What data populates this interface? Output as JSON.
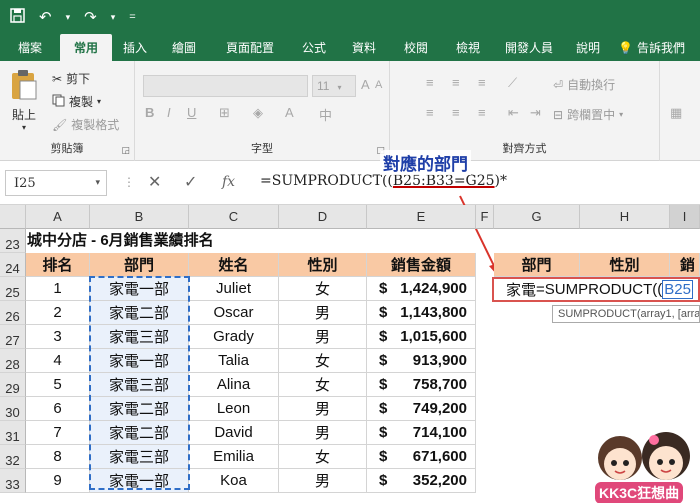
{
  "quick_access": {
    "save_icon": "save-icon",
    "undo_icon": "undo-icon",
    "redo_icon": "redo-icon",
    "customize_icon": "customize-icon"
  },
  "ribbon_tabs": [
    "檔案",
    "常用",
    "插入",
    "繪圖",
    "頁面配置",
    "公式",
    "資料",
    "校閱",
    "檢視",
    "開發人員",
    "說明",
    "告訴我們"
  ],
  "active_tab": "常用",
  "clipboard": {
    "paste": "貼上",
    "cut": "剪下",
    "copy": "複製",
    "format_painter": "複製格式",
    "group_label": "剪貼簿"
  },
  "font_group": {
    "size": "11",
    "group_label": "字型"
  },
  "alignment": {
    "wrap_text": "自動換行",
    "merge_center": "跨欄置中",
    "group_label": "對齊方式"
  },
  "formula_bar": {
    "name_box": "I25",
    "fx": "fx",
    "formula_prefix": "=SUMPRODUCT((",
    "formula_highlight": "B25:B33=G25",
    "formula_suffix": ")*"
  },
  "annotation": "對應的部門",
  "columns": [
    "A",
    "B",
    "C",
    "D",
    "E",
    "F",
    "G",
    "H",
    "I"
  ],
  "sheet_title": "城中分店 - 6月銷售業績排名",
  "table_headers": [
    "排名",
    "部門",
    "姓名",
    "性別",
    "銷售金額"
  ],
  "rows": [
    {
      "row": "25",
      "rank": "1",
      "dept": "家電一部",
      "name": "Juliet",
      "gender": "女",
      "currency": "$",
      "amount": "1,424,900"
    },
    {
      "row": "26",
      "rank": "2",
      "dept": "家電二部",
      "name": "Oscar",
      "gender": "男",
      "currency": "$",
      "amount": "1,143,800"
    },
    {
      "row": "27",
      "rank": "3",
      "dept": "家電三部",
      "name": "Grady",
      "gender": "男",
      "currency": "$",
      "amount": "1,015,600"
    },
    {
      "row": "28",
      "rank": "4",
      "dept": "家電一部",
      "name": "Talia",
      "gender": "女",
      "currency": "$",
      "amount": "913,900"
    },
    {
      "row": "29",
      "rank": "5",
      "dept": "家電三部",
      "name": "Alina",
      "gender": "女",
      "currency": "$",
      "amount": "758,700"
    },
    {
      "row": "30",
      "rank": "6",
      "dept": "家電二部",
      "name": "Leon",
      "gender": "男",
      "currency": "$",
      "amount": "749,200"
    },
    {
      "row": "31",
      "rank": "7",
      "dept": "家電二部",
      "name": "David",
      "gender": "男",
      "currency": "$",
      "amount": "714,100"
    },
    {
      "row": "32",
      "rank": "8",
      "dept": "家電三部",
      "name": "Emilia",
      "gender": "女",
      "currency": "$",
      "amount": "671,600"
    },
    {
      "row": "33",
      "rank": "9",
      "dept": "家電一部",
      "name": "Koa",
      "gender": "男",
      "currency": "$",
      "amount": "352,200"
    }
  ],
  "row_numbers_top": [
    "23",
    "24"
  ],
  "lookup_headers": [
    "部門",
    "性別",
    "銷"
  ],
  "edit_cell": {
    "prefix": "家電",
    "formula": "=SUMPRODUCT((",
    "ref": "B25"
  },
  "tooltip": "SUMPRODUCT(array1, [array2], ...)",
  "logo": "KK3C狂想曲",
  "colors": {
    "excel_green": "#217346",
    "header_fill": "#f9c9a4",
    "dept_fill": "#eaf1fb",
    "annotation_blue": "#1f3fa8",
    "arrow_red": "#d9342b"
  }
}
